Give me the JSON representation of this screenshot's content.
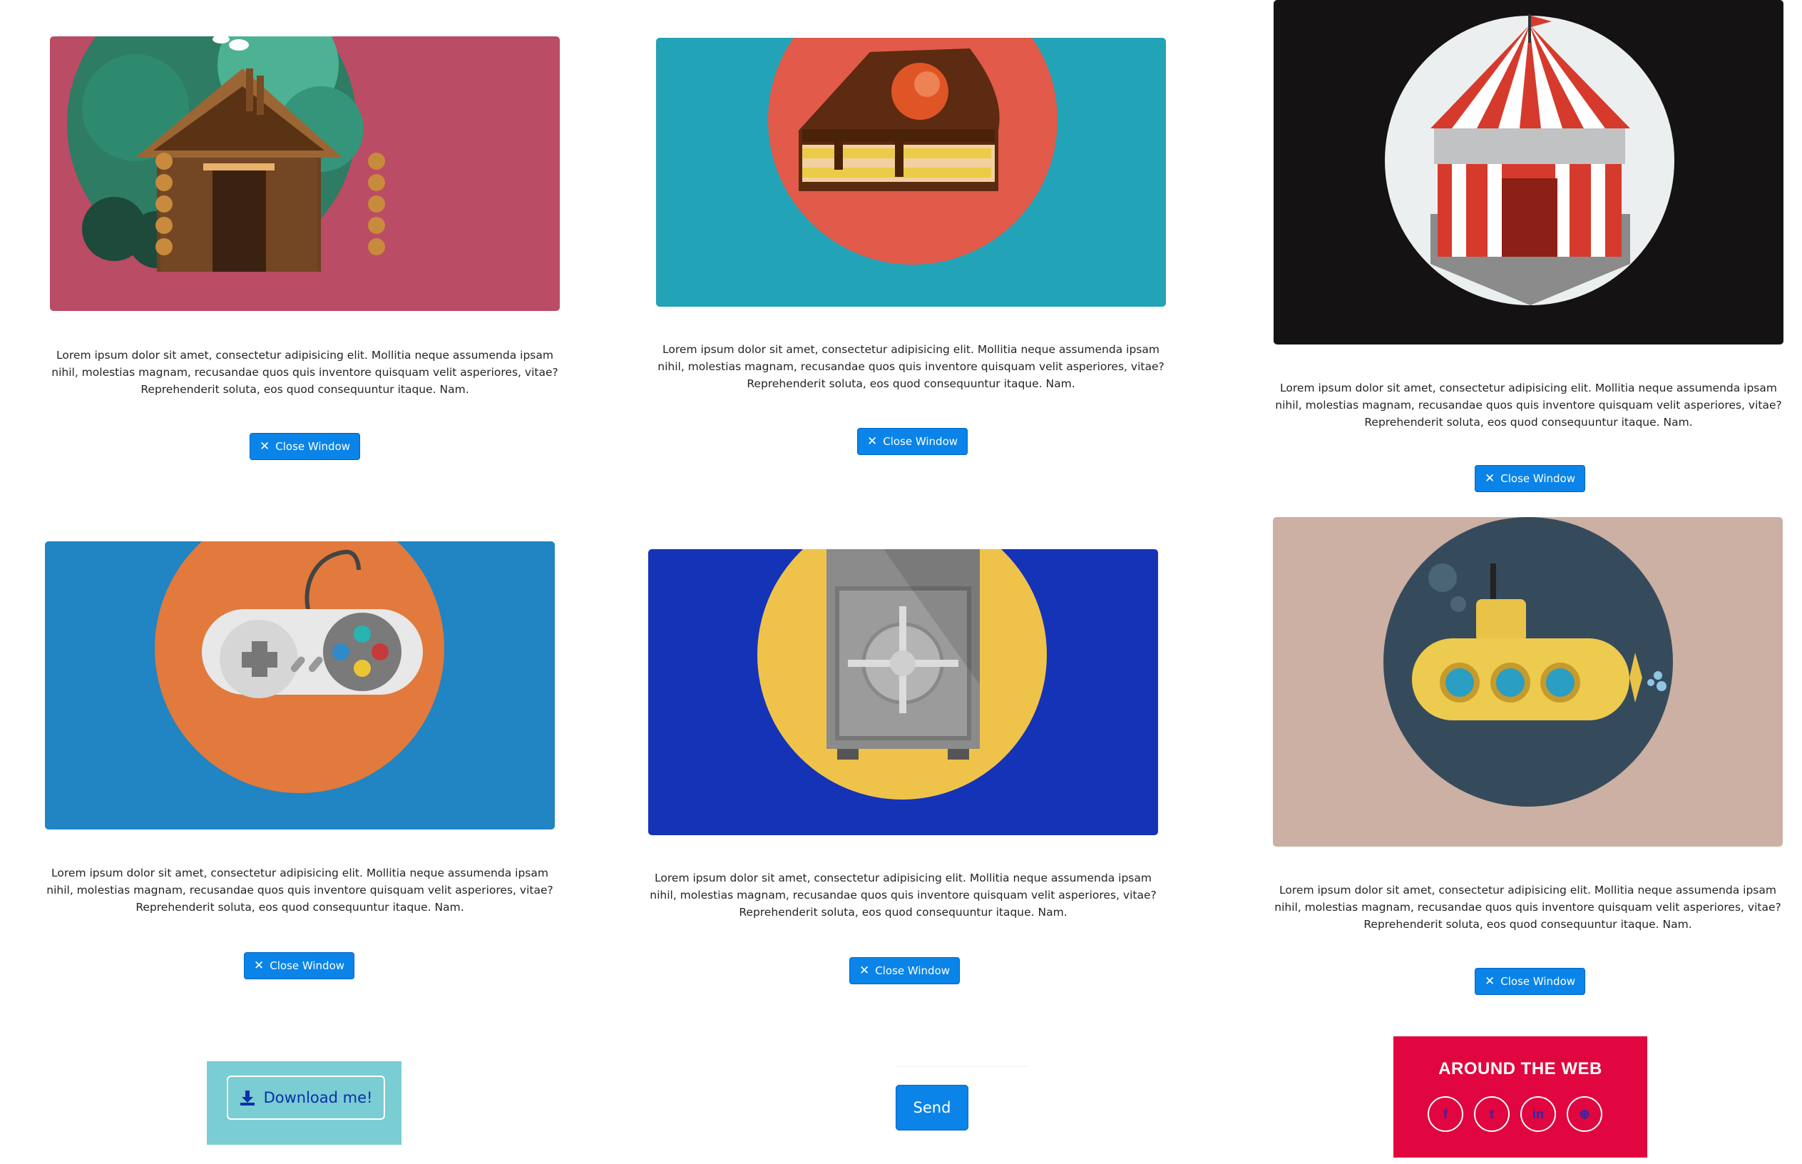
{
  "portfolio": {
    "description": "Lorem ipsum dolor sit amet, consectetur adipisicing elit. Mollitia neque assumenda ipsam nihil, molestias magnam, recusandae quos quis inventore quisquam velit asperiores, vitae? Reprehenderit soluta, eos quod consequuntur itaque. Nam.",
    "close_label": "Close Window",
    "items": [
      {
        "name": "cabin",
        "bg": "#ba4c65",
        "circle": "#2d7c63"
      },
      {
        "name": "cake",
        "bg": "#22a3b7",
        "circle": "#e25a49"
      },
      {
        "name": "circus",
        "bg": "#141212",
        "circle": "#eceff0"
      },
      {
        "name": "game-controller",
        "bg": "#2184c3",
        "circle": "#e17a3c"
      },
      {
        "name": "safe",
        "bg": "#1433b6",
        "circle": "#efc34a"
      },
      {
        "name": "submarine",
        "bg": "#cbb0a3",
        "circle": "#354b5c"
      }
    ]
  },
  "download": {
    "label": "Download me!"
  },
  "contact": {
    "send_label": "Send"
  },
  "around_web": {
    "title": "AROUND THE WEB",
    "links": [
      {
        "icon": "facebook-icon",
        "glyph": "f"
      },
      {
        "icon": "twitter-icon",
        "glyph": "t"
      },
      {
        "icon": "linkedin-icon",
        "glyph": "in"
      },
      {
        "icon": "dribbble-icon",
        "glyph": "⊛"
      }
    ]
  }
}
